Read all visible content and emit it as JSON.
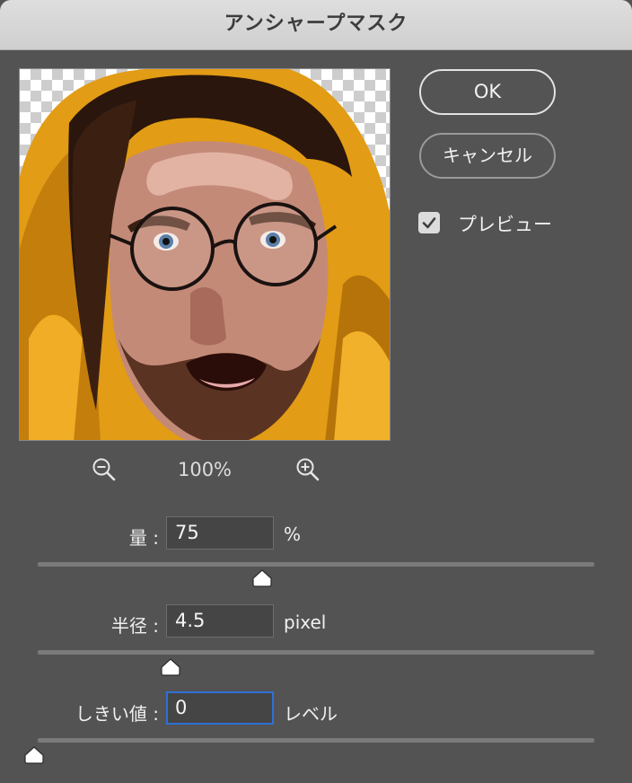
{
  "dialog": {
    "title": "アンシャープマスク"
  },
  "buttons": {
    "ok": "OK",
    "cancel": "キャンセル"
  },
  "preview": {
    "label": "プレビュー",
    "checked": true,
    "zoom_level": "100%"
  },
  "fields": {
    "amount": {
      "label": "量 :",
      "value": "75",
      "unit": "%",
      "slider_fraction": 0.4
    },
    "radius": {
      "label": "半径 :",
      "value": "4.5",
      "unit": "pixel",
      "slider_fraction": 0.24
    },
    "threshold": {
      "label": "しきい値 :",
      "value": "0",
      "unit": "レベル",
      "slider_fraction": 0.0
    }
  },
  "icons": {
    "zoom_out": "zoom-out-icon",
    "zoom_in": "zoom-in-icon",
    "checkbox": "checkmark-icon"
  },
  "colors": {
    "dialog_bg": "#535353",
    "focus_ring": "#2f6fd8",
    "hood": "#e09a14"
  }
}
